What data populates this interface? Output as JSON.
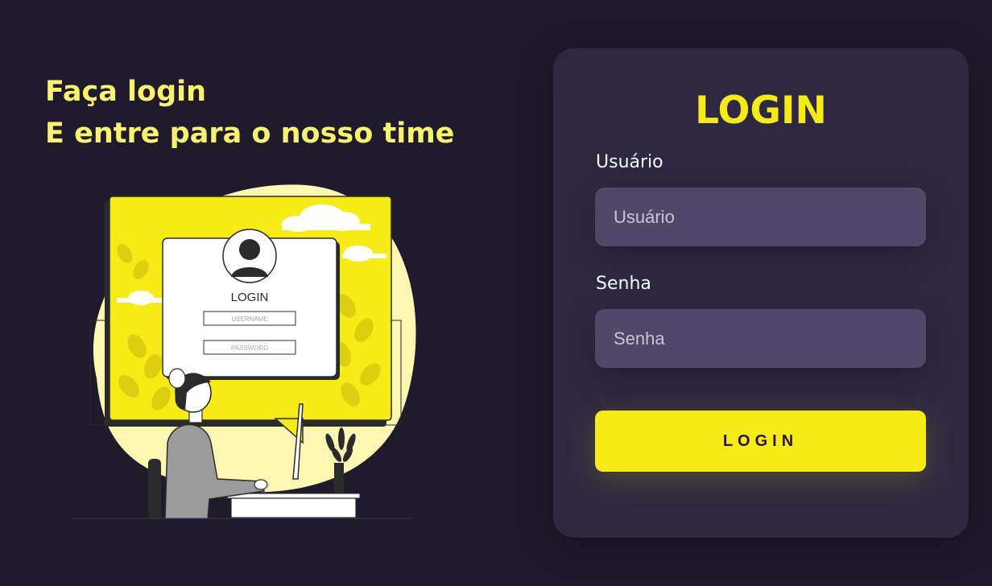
{
  "hero": {
    "line1": "Faça login",
    "line2": "E entre para o nosso time"
  },
  "illustration": {
    "card_title": "LOGIN",
    "username_placeholder": "USERNAME",
    "password_placeholder": "PASSWORD"
  },
  "login_card": {
    "title": "LOGIN",
    "username_label": "Usuário",
    "username_placeholder": "Usuário",
    "password_label": "Senha",
    "password_placeholder": "Senha",
    "submit_label": "LOGIN"
  },
  "colors": {
    "background": "#201b2c",
    "card": "#2f2841",
    "input": "#514869",
    "accent": "#f6eb16",
    "hero_text": "#faf26f"
  }
}
